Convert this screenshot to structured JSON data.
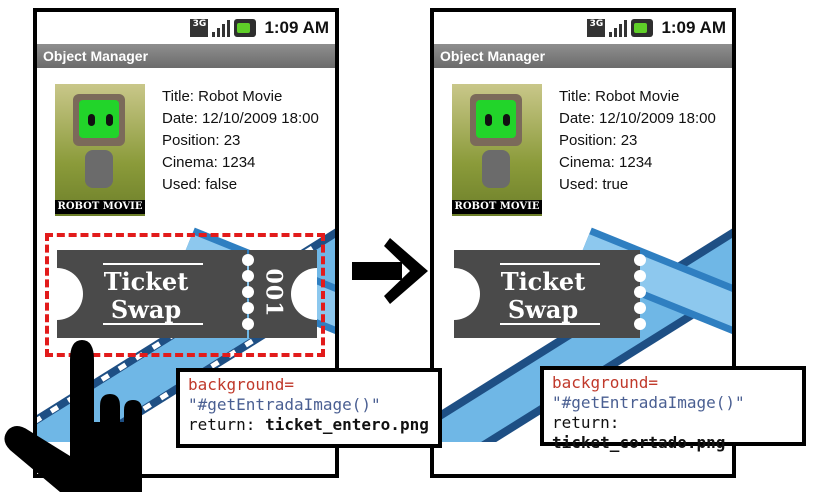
{
  "statusbar": {
    "network": "3G",
    "time": "1:09 AM"
  },
  "app": {
    "title": "Object Manager"
  },
  "poster": {
    "label": "ROBOT MOVIE"
  },
  "screens": [
    {
      "title_line": "Title: Robot Movie",
      "date_line": "Date: 12/10/2009 18:00",
      "position_line": "Position: 23",
      "cinema_line": "Cinema: 1234",
      "used_line": "Used: false",
      "ticket": {
        "line1": "Ticket",
        "line2": "Swap",
        "stub": "001",
        "state": "entero"
      },
      "code": {
        "attr": "background=",
        "expr": "\"#getEntradaImage()\"",
        "return_label": "return:",
        "return_value": "ticket_entero.png"
      }
    },
    {
      "title_line": "Title: Robot Movie",
      "date_line": "Date: 12/10/2009 18:00",
      "position_line": "Position: 23",
      "cinema_line": "Cinema: 1234",
      "used_line": "Used: true",
      "ticket": {
        "line1": "Ticket",
        "line2": "Swap",
        "state": "cortado"
      },
      "code": {
        "attr": "background=",
        "expr": "\"#getEntradaImage()\"",
        "return_label": "return:",
        "return_value": "ticket_cortado.png"
      }
    }
  ],
  "icons": [
    "3g-icon",
    "signal-icon",
    "battery-icon",
    "right-arrow-icon",
    "hand-pointer-icon"
  ],
  "colors": {
    "highlight_dashed": "#e21b1b",
    "ticket": "#4a4a4a",
    "film_blue": "#2f7fc1",
    "screen_green": "#22d42a"
  }
}
